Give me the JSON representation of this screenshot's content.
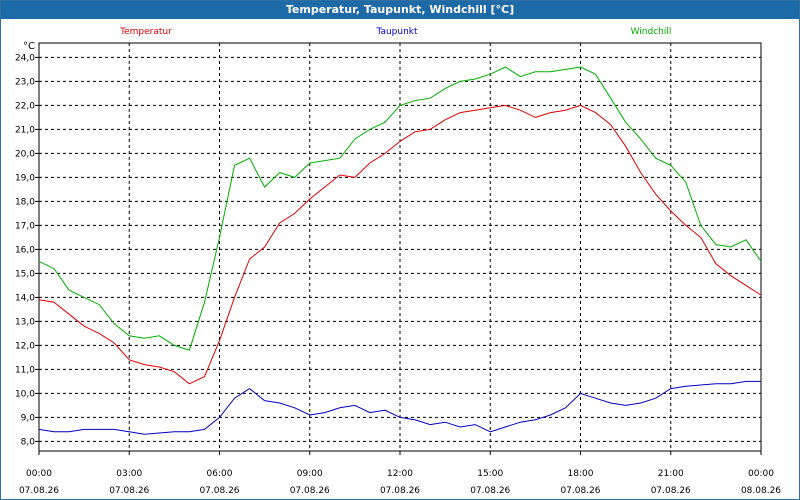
{
  "window": {
    "title": "Temperatur, Taupunkt, Windchill [°C]"
  },
  "chart_data": {
    "type": "line",
    "title": "Temperatur, Taupunkt, Windchill [°C]",
    "ylabel": "°C",
    "ylim": [
      7.6,
      24.6
    ],
    "yticks": [
      "8,0",
      "9,0",
      "10,0",
      "11,0",
      "12,0",
      "13,0",
      "14,0",
      "15,0",
      "16,0",
      "17,0",
      "18,0",
      "19,0",
      "20,0",
      "21,0",
      "22,0",
      "23,0",
      "24,0"
    ],
    "xlim": [
      0,
      24
    ],
    "xticks": [
      {
        "time": "00:00",
        "date": "07.08.26"
      },
      {
        "time": "03:00",
        "date": "07.08.26"
      },
      {
        "time": "06:00",
        "date": "07.08.26"
      },
      {
        "time": "09:00",
        "date": "07.08.26"
      },
      {
        "time": "12:00",
        "date": "07.08.26"
      },
      {
        "time": "15:00",
        "date": "07.08.26"
      },
      {
        "time": "18:00",
        "date": "07.08.26"
      },
      {
        "time": "21:00",
        "date": "07.08.26"
      },
      {
        "time": "00:00",
        "date": "08.08.26"
      }
    ],
    "grid": true,
    "x": [
      0,
      0.5,
      1,
      1.5,
      2,
      2.5,
      3,
      3.5,
      4,
      4.5,
      5,
      5.5,
      6,
      6.5,
      7,
      7.5,
      8,
      8.5,
      9,
      9.5,
      10,
      10.5,
      11,
      11.5,
      12,
      12.5,
      13,
      13.5,
      14,
      14.5,
      15,
      15.5,
      16,
      16.5,
      17,
      17.5,
      18,
      18.5,
      19,
      19.5,
      20,
      20.5,
      21,
      21.5,
      22,
      22.5,
      23,
      23.5,
      24
    ],
    "series": [
      {
        "name": "Temperatur",
        "color": "#e00000",
        "values": [
          13.9,
          13.8,
          13.3,
          12.8,
          12.5,
          12.1,
          11.4,
          11.2,
          11.1,
          10.9,
          10.4,
          10.7,
          12.2,
          14.0,
          15.6,
          16.1,
          17.1,
          17.5,
          18.1,
          18.6,
          19.1,
          19.0,
          19.6,
          20.0,
          20.5,
          20.9,
          21.0,
          21.4,
          21.7,
          21.8,
          21.9,
          22.0,
          21.8,
          21.5,
          21.7,
          21.8,
          22.0,
          21.7,
          21.2,
          20.3,
          19.2,
          18.3,
          17.6,
          17.0,
          16.5,
          15.4,
          14.9,
          14.5,
          14.1
        ]
      },
      {
        "name": "Taupunkt",
        "color": "#0000c0",
        "values": [
          8.5,
          8.4,
          8.4,
          8.5,
          8.5,
          8.5,
          8.4,
          8.3,
          8.35,
          8.4,
          8.4,
          8.5,
          9.0,
          9.8,
          10.2,
          9.7,
          9.6,
          9.4,
          9.1,
          9.2,
          9.4,
          9.5,
          9.2,
          9.3,
          9.0,
          8.9,
          8.7,
          8.8,
          8.6,
          8.7,
          8.4,
          8.6,
          8.8,
          8.9,
          9.1,
          9.4,
          10.0,
          9.8,
          9.6,
          9.5,
          9.6,
          9.8,
          10.2,
          10.3,
          10.35,
          10.4,
          10.4,
          10.5,
          10.5
        ]
      },
      {
        "name": "Windchill",
        "color": "#00b000",
        "values": [
          15.5,
          15.2,
          14.3,
          14.0,
          13.7,
          12.9,
          12.4,
          12.3,
          12.4,
          12.0,
          11.8,
          13.8,
          16.5,
          19.5,
          19.8,
          18.6,
          19.2,
          19.0,
          19.6,
          19.7,
          19.8,
          20.6,
          21.0,
          21.3,
          22.0,
          22.2,
          22.3,
          22.7,
          23.0,
          23.1,
          23.3,
          23.6,
          23.2,
          23.4,
          23.4,
          23.5,
          23.6,
          23.3,
          22.3,
          21.3,
          20.6,
          19.8,
          19.5,
          18.8,
          17.0,
          16.2,
          16.1,
          16.4,
          15.5
        ]
      }
    ]
  }
}
